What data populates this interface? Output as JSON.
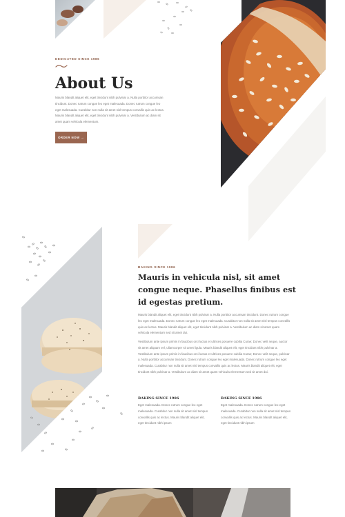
{
  "hero": {
    "eyebrow": "DEDICATED SINCE 1986",
    "title": "About Us",
    "body": "Mauris blandit aliquet elit, eget tincidunt nibh pulvinar a. Nulla porttitor accumsan tincidunt. Donec rutrum congue leo eget malesuada. Donec rutrum congue leo eget malesuada. Curabitur non nulla sit amet nisl tempus convallis quis ac lectus. Mauris blandit aliquet elit, eget tincidunt nibh pulvinar a. Vestibulum ac diam sit amet quam vehicula elementum.",
    "button_label": "ORDER NOW  →"
  },
  "story": {
    "eyebrow": "BAKING SINCE 1986",
    "heading": "Mauris in vehicula nisl, sit amet congue neque. Phasellus finibus est id egestas pretium.",
    "paragraph1": "Mauris blandit aliquet elit, eget tincidunt nibh pulvinar a. Nulla porttitor accumsan tincidunt. Donec rutrum congue leo eget malesuada. Donec rutrum congue leo eget malesuada. Curabitur non nulla sit amet nisl tempus convallis quis ac lectus. Mauris blandit aliquet elit, eget tincidunt nibh pulvinar a. Vestibulum ac diam sit amet quam vehicula elementum sed sit amet dui.",
    "paragraph2": "Vestibulum ante ipsum primis in faucibus orci luctus et ultrices posuere cubilia Curae; Donec velit neque, auctor sit amet aliquam vel, ullamcorper sit amet ligula. Mauris blandit aliquet elit, eget tincidunt nibh pulvinar a. Vestibulum ante ipsum primis in faucibus orci luctus et ultrices posuere cubilia Curae; Donec velit neque, pulvinar a. Nulla porttitor accumsan tincidunt. Donec rutrum congue leo eget malesuada. Donec rutrum congue leo eget malesuada. Curabitur non nulla sit amet nisl tempus convallis quis ac lectus. Mauris blandit aliquet elit, eget tincidunt nibh pulvinar a. Vestibulum ac diam sit amet quam vehicula elementum sed sit amet dui.",
    "columns": [
      {
        "title": "BAKING SINCE 1986",
        "body": "Eget malesuada. Donec rutrum congue leo eget malesuada. Curabitur non nulla sit amet nisl tempus convallis quis ac lectus. Mauris blandit aliquet elit, eget tincidunt nibh ipsum"
      },
      {
        "title": "BAKING SINCE 1986",
        "body": "Eget malesuada. Donec rutrum congue leo eget malesuada. Curabitur non nulla sit amet nisl tempus convallis quis ac lectus. Mauris blandit aliquet elit, eget tincidunt nibh ipsum"
      }
    ]
  },
  "colors": {
    "accent": "#9a6650",
    "eyebrow": "#8a5a44",
    "heading": "#262626",
    "body": "#7a7a7a",
    "cream": "#f6efe9"
  },
  "icons": {
    "button_arrow": "arrow-right-icon",
    "divider": "squiggle-divider-icon"
  }
}
